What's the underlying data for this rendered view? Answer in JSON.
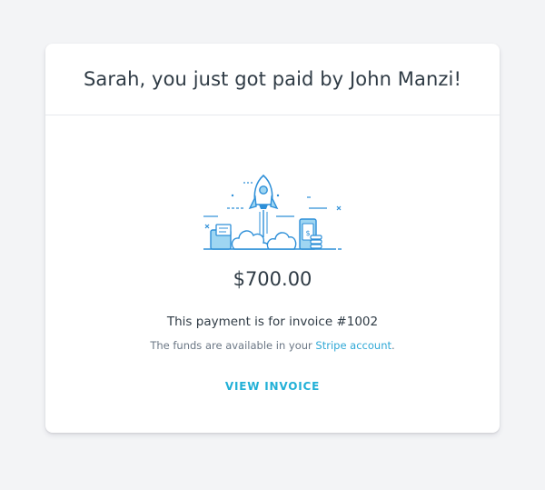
{
  "header": {
    "title": "Sarah, you just got paid by John Manzi!"
  },
  "payment": {
    "amount": "$700.00",
    "invoice_line": "This payment is for invoice #1002",
    "funds_prefix": "The funds are available in your ",
    "funds_link": "Stripe account",
    "funds_suffix": "."
  },
  "actions": {
    "view_invoice_label": "VIEW INVOICE"
  },
  "colors": {
    "accent": "#21b0d7",
    "link": "#2fa8d6",
    "text": "#2f3b45",
    "muted": "#6b7785",
    "background": "#f3f4f6"
  },
  "icons": {
    "illustration": "rocket-launch-illustration"
  }
}
